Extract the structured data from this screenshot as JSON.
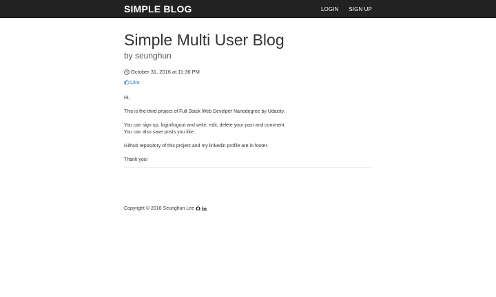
{
  "navbar": {
    "brand": "SIMPLE BLOG",
    "links": [
      "LOGIN",
      "SIGN UP"
    ]
  },
  "post": {
    "title": "Simple Multi User Blog",
    "author": "by seunghun",
    "date": "October 31, 2016 at 11:36 PM",
    "like_label": "Like",
    "paragraphs": [
      [
        "Hi,"
      ],
      [
        "This is the third project of Full Stack Web Develper Nanodegree by Udacity."
      ],
      [
        "You can sign up, login/logout and write, edit, delete your post and comment.",
        "You can also save posts you like."
      ],
      [
        "Github repository of this project and my linkedin profile are in footer."
      ],
      [
        "Thank you!"
      ]
    ]
  },
  "footer": {
    "copyright": "Copyright © 2016 Seunghun Lee",
    "icons": [
      "github-icon",
      "linkedin-icon"
    ]
  },
  "colors": {
    "navbar_bg": "#222222",
    "link": "#337ab7",
    "text": "#333333"
  }
}
